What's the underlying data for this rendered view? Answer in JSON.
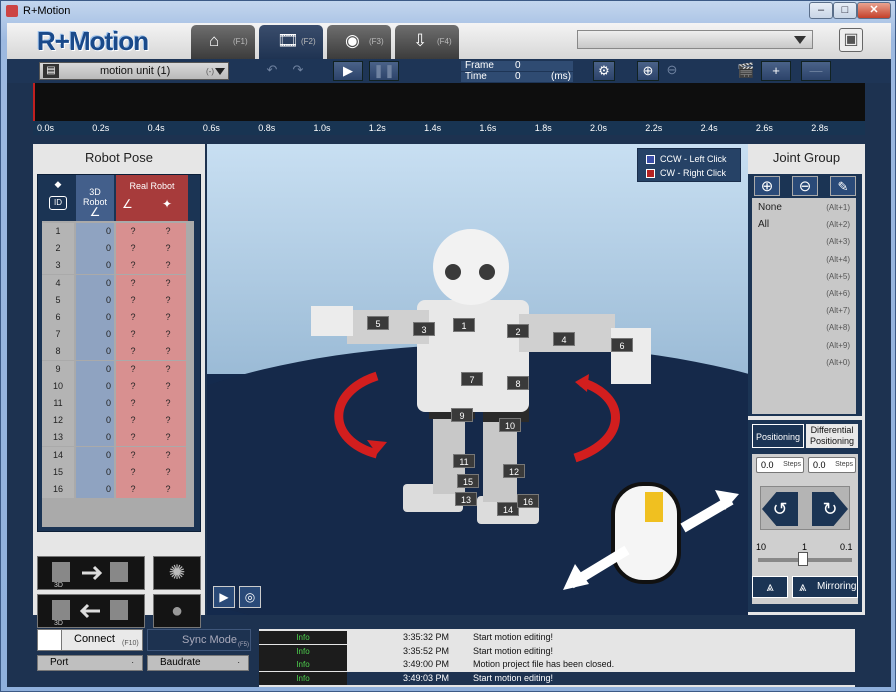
{
  "window": {
    "title": "R+Motion",
    "min": "–",
    "max": "□",
    "close": "✕"
  },
  "app": {
    "logo": "R+Motion"
  },
  "tabs": [
    {
      "icon": "⌂",
      "key": "(F1)"
    },
    {
      "icon": "🎞",
      "key": "(F2)"
    },
    {
      "icon": "◉",
      "key": "(F3)"
    },
    {
      "icon": "⇩",
      "key": "(F4)"
    }
  ],
  "toolbar": {
    "unit_label": "motion unit (1)",
    "unit_suffix": "(-)",
    "frame_label": "Frame",
    "frame_value": "0",
    "time_label": "Time",
    "time_value": "0",
    "time_unit": "(ms)"
  },
  "timeline": {
    "ticks": [
      "0.0s",
      "0.2s",
      "0.4s",
      "0.6s",
      "0.8s",
      "1.0s",
      "1.2s",
      "1.4s",
      "1.6s",
      "1.8s",
      "2.0s",
      "2.2s",
      "2.4s",
      "2.6s",
      "2.8s"
    ]
  },
  "robot_pose": {
    "title": "Robot Pose",
    "col_id": "ID",
    "col_3d": "3D\nRobot",
    "col_real": "Real Robot",
    "rows": [
      {
        "id": "1",
        "v3d": "0",
        "r1": "?",
        "r2": "?"
      },
      {
        "id": "2",
        "v3d": "0",
        "r1": "?",
        "r2": "?"
      },
      {
        "id": "3",
        "v3d": "0",
        "r1": "?",
        "r2": "?"
      },
      {
        "id": "4",
        "v3d": "0",
        "r1": "?",
        "r2": "?"
      },
      {
        "id": "5",
        "v3d": "0",
        "r1": "?",
        "r2": "?"
      },
      {
        "id": "6",
        "v3d": "0",
        "r1": "?",
        "r2": "?"
      },
      {
        "id": "7",
        "v3d": "0",
        "r1": "?",
        "r2": "?"
      },
      {
        "id": "8",
        "v3d": "0",
        "r1": "?",
        "r2": "?"
      },
      {
        "id": "9",
        "v3d": "0",
        "r1": "?",
        "r2": "?"
      },
      {
        "id": "10",
        "v3d": "0",
        "r1": "?",
        "r2": "?"
      },
      {
        "id": "11",
        "v3d": "0",
        "r1": "?",
        "r2": "?"
      },
      {
        "id": "12",
        "v3d": "0",
        "r1": "?",
        "r2": "?"
      },
      {
        "id": "13",
        "v3d": "0",
        "r1": "?",
        "r2": "?"
      },
      {
        "id": "14",
        "v3d": "0",
        "r1": "?",
        "r2": "?"
      },
      {
        "id": "15",
        "v3d": "0",
        "r1": "?",
        "r2": "?"
      },
      {
        "id": "16",
        "v3d": "0",
        "r1": "?",
        "r2": "?"
      }
    ]
  },
  "viewport": {
    "legend_ccw": "CCW  - Left Click",
    "legend_cw": "CW   - Right Click",
    "ccw_color": "#3b4ea8",
    "cw_color": "#b52222",
    "joint_labels": [
      "1",
      "2",
      "3",
      "4",
      "5",
      "6",
      "7",
      "8",
      "9",
      "10",
      "11",
      "12",
      "13",
      "14",
      "15",
      "16"
    ]
  },
  "joint_group": {
    "title": "Joint Group",
    "rows": [
      {
        "name": "None",
        "key": "(Alt+1)"
      },
      {
        "name": "All",
        "key": "(Alt+2)"
      },
      {
        "name": "",
        "key": "(Alt+3)"
      },
      {
        "name": "",
        "key": "(Alt+4)"
      },
      {
        "name": "",
        "key": "(Alt+5)"
      },
      {
        "name": "",
        "key": "(Alt+6)"
      },
      {
        "name": "",
        "key": "(Alt+7)"
      },
      {
        "name": "",
        "key": "(Alt+8)"
      },
      {
        "name": "",
        "key": "(Alt+9)"
      },
      {
        "name": "",
        "key": "(Alt+0)"
      }
    ]
  },
  "positioning": {
    "tab1": "Positioning",
    "tab2a": "Differential",
    "tab2b": "Positioning",
    "steps1": "0.0",
    "steps2": "0.0",
    "steps_label": "Steps",
    "slider_min": "10",
    "slider_mid": "1",
    "slider_max": "0.1",
    "mirroring": "Mirroring"
  },
  "connection": {
    "connect": "Connect",
    "connect_key": "(F10)",
    "sync": "Sync Mode",
    "sync_key": "(F5)",
    "port": "Port",
    "baudrate": "Baudrate"
  },
  "log": [
    {
      "level": "Info",
      "time": "3:35:32 PM",
      "msg": "Start motion editing!"
    },
    {
      "level": "Info",
      "time": "3:35:52 PM",
      "msg": "Start motion editing!"
    },
    {
      "level": "Info",
      "time": "3:49:00 PM",
      "msg": "Motion project file has been closed."
    },
    {
      "level": "Info",
      "time": "3:49:03 PM",
      "msg": "Start motion editing!"
    }
  ]
}
